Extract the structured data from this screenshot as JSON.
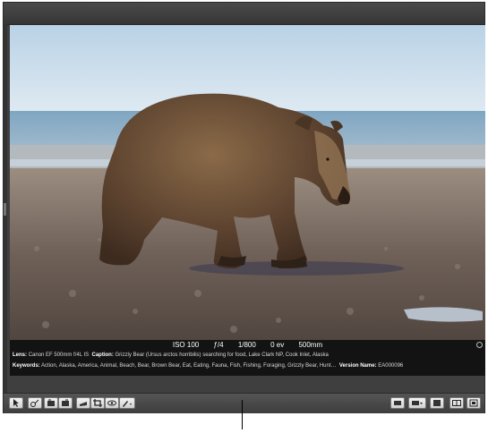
{
  "viewer": {
    "photo_subject_icon": "brown-bear-walking-on-beach-photo"
  },
  "metadata": {
    "exposure": {
      "iso": "ISO 100",
      "aperture": "ƒ/4",
      "shutter": "1/800",
      "ev": "0 ev",
      "focal_length": "500mm"
    },
    "lens_label": "Lens:",
    "lens_value": "Canon EF 500mm f/4L IS",
    "caption_label": "Caption:",
    "caption_value": "Grizzly Bear (Ursus arctos horribilis) searching for food, Lake Clark NP, Cook Inlet, Alaska",
    "keywords_label": "Keywords:",
    "keywords_value": "Action, Alaska, America, Animal, Beach, Bear, Brown Bear, Eat, Eating, Fauna, Fish, Fishing, Foraging, Grizzly Bear, Hunt…",
    "version_label": "Version Name:",
    "version_value": "EA000096"
  },
  "toolbar": {
    "left_tools": [
      "select-pointer-icon",
      "lift-stamp-icon",
      "rotate-left-icon",
      "rotate-right-icon",
      "straighten-icon",
      "crop-icon",
      "red-eye-icon",
      "brush-icon"
    ],
    "right_tools": [
      "loupe-icon",
      "viewer-mode-icon",
      "inspector-icon",
      "split-view-icon",
      "fullscreen-icon"
    ]
  }
}
